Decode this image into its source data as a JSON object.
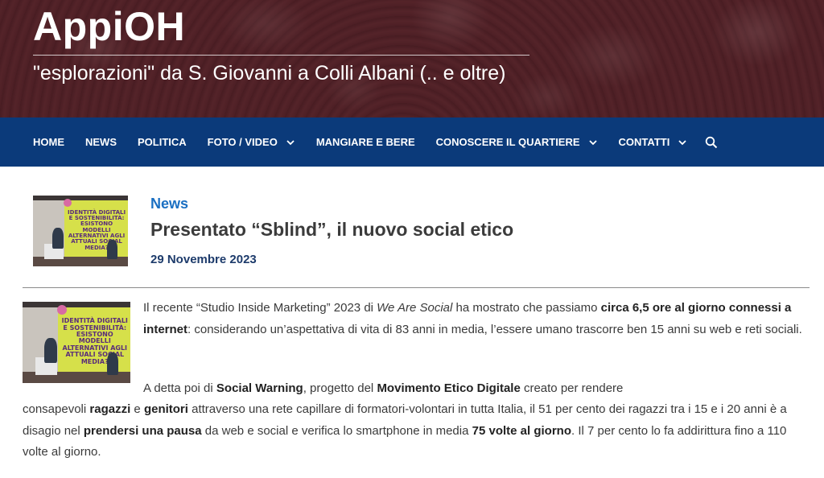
{
  "site": {
    "title": "AppiOH",
    "tagline": "\"esplorazioni\" da S. Giovanni a Colli Albani (.. e oltre)"
  },
  "nav": {
    "items": [
      {
        "label": "HOME",
        "dropdown": false
      },
      {
        "label": "NEWS",
        "dropdown": false
      },
      {
        "label": "POLITICA",
        "dropdown": false
      },
      {
        "label": "FOTO / VIDEO",
        "dropdown": true
      },
      {
        "label": "MANGIARE E BERE",
        "dropdown": false
      },
      {
        "label": "CONOSCERE IL QUARTIERE",
        "dropdown": true
      },
      {
        "label": "CONTATTI",
        "dropdown": true
      }
    ],
    "search_icon": "search-icon"
  },
  "article": {
    "category": "News",
    "title": "Presentato “Sblind”, il nuovo social etico",
    "date": "29 Novembre 2023",
    "image_text": "IDENTITÀ DIGITALI E SOSTENIBILITÀ: ESISTONO MODELLI ALTERNATIVI AGLI ATTUALI SOCIAL MEDIA?",
    "p1": [
      {
        "t": "Il recente “Studio Inside Marketing” 2023 di ",
        "s": "n"
      },
      {
        "t": "We Are Social",
        "s": "i"
      },
      {
        "t": " ha mostrato che passiamo ",
        "s": "n"
      },
      {
        "t": "circa 6,5 ore al giorno connessi a internet",
        "s": "b"
      },
      {
        "t": ": considerando un’aspettativa di vita di 83 anni in media, l’essere umano trascorre ben 15 anni su web e reti sociali.",
        "s": "n"
      }
    ],
    "p2a": [
      {
        "t": "A detta poi di ",
        "s": "n"
      },
      {
        "t": "Social Warning",
        "s": "b"
      },
      {
        "t": ", progetto del ",
        "s": "n"
      },
      {
        "t": "Movimento Etico Digitale",
        "s": "b"
      },
      {
        "t": " creato per rendere",
        "s": "n"
      }
    ],
    "p2b": [
      {
        "t": "consapevoli ",
        "s": "n"
      },
      {
        "t": "ragazzi",
        "s": "b"
      },
      {
        "t": " e ",
        "s": "n"
      },
      {
        "t": "genitori",
        "s": "b"
      },
      {
        "t": " attraverso una rete capillare di formatori-volontari in tutta Italia, il 51 per cento dei ragazzi tra i 15 e i 20 anni è a disagio nel ",
        "s": "n"
      },
      {
        "t": "prendersi una pausa",
        "s": "b"
      },
      {
        "t": " da web e social e verifica lo smartphone in media ",
        "s": "n"
      },
      {
        "t": "75 volte al giorno",
        "s": "b"
      },
      {
        "t": ". Il 7 per cento lo fa addirittura fino a 110 volte al giorno.",
        "s": "n"
      }
    ]
  },
  "colors": {
    "nav_bg": "#0b3a7a",
    "category": "#1a6fc2",
    "date": "#1d3b6b"
  }
}
